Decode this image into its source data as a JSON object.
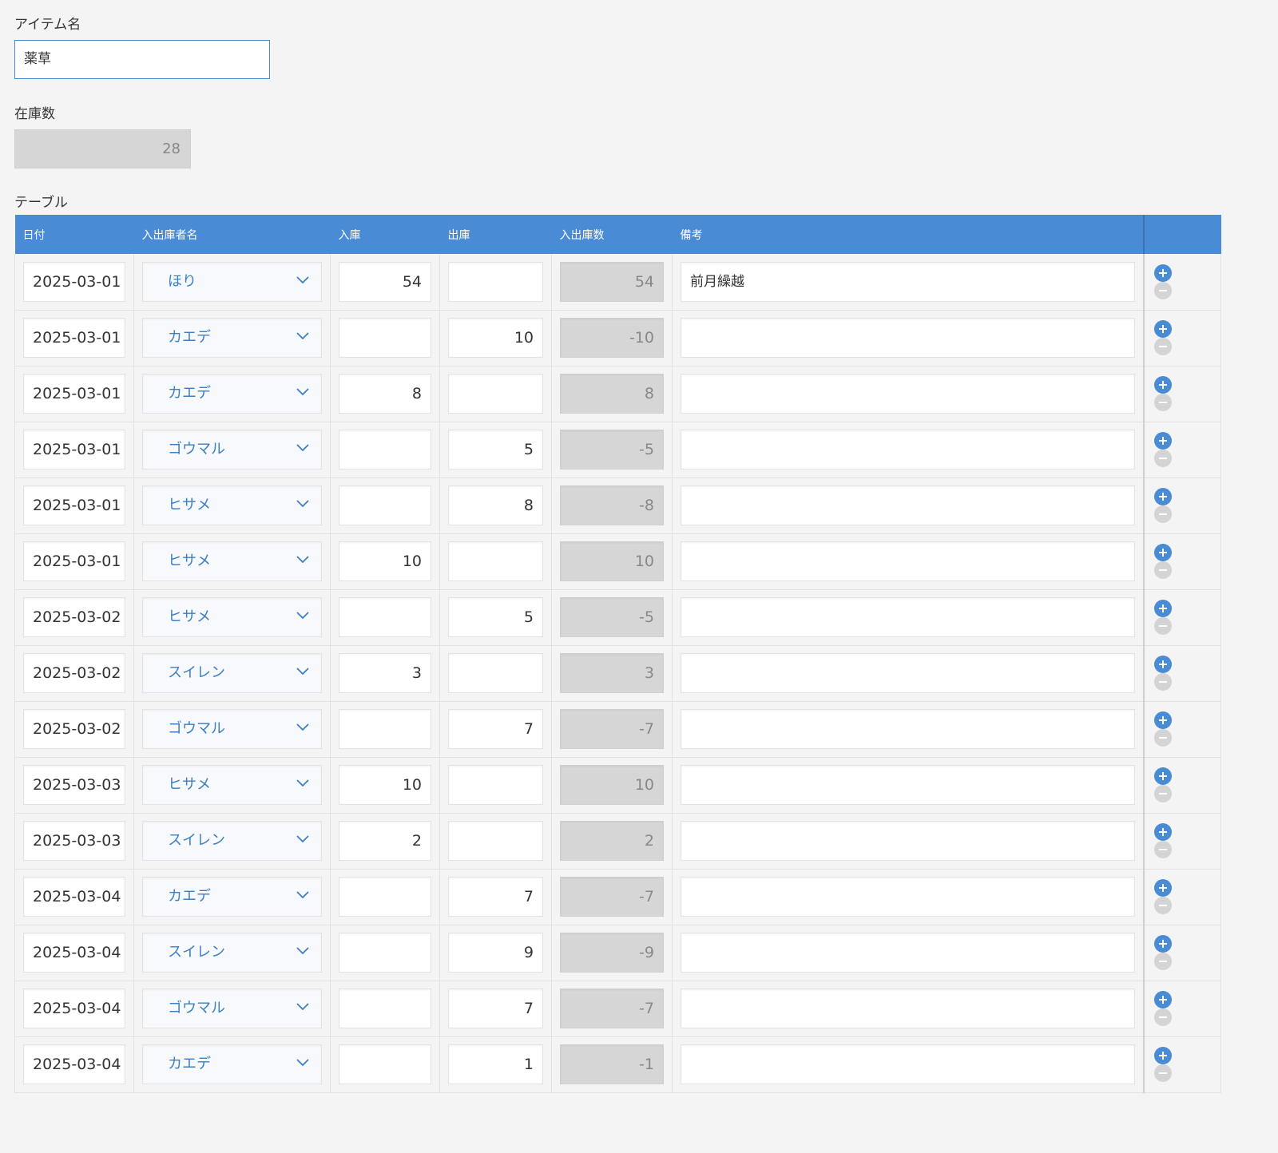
{
  "item_name": {
    "label": "アイテム名",
    "value": "薬草"
  },
  "stock": {
    "label": "在庫数",
    "value": "28"
  },
  "table": {
    "label": "テーブル",
    "columns": [
      "日付",
      "入出庫者名",
      "入庫",
      "出庫",
      "入出庫数",
      "備考"
    ],
    "rows": [
      {
        "date": "2025-03-01",
        "person": "ほり",
        "in": "54",
        "out": "",
        "net": "54",
        "memo": "前月繰越"
      },
      {
        "date": "2025-03-01",
        "person": "カエデ",
        "in": "",
        "out": "10",
        "net": "-10",
        "memo": ""
      },
      {
        "date": "2025-03-01",
        "person": "カエデ",
        "in": "8",
        "out": "",
        "net": "8",
        "memo": ""
      },
      {
        "date": "2025-03-01",
        "person": "ゴウマル",
        "in": "",
        "out": "5",
        "net": "-5",
        "memo": ""
      },
      {
        "date": "2025-03-01",
        "person": "ヒサメ",
        "in": "",
        "out": "8",
        "net": "-8",
        "memo": ""
      },
      {
        "date": "2025-03-01",
        "person": "ヒサメ",
        "in": "10",
        "out": "",
        "net": "10",
        "memo": ""
      },
      {
        "date": "2025-03-02",
        "person": "ヒサメ",
        "in": "",
        "out": "5",
        "net": "-5",
        "memo": ""
      },
      {
        "date": "2025-03-02",
        "person": "スイレン",
        "in": "3",
        "out": "",
        "net": "3",
        "memo": ""
      },
      {
        "date": "2025-03-02",
        "person": "ゴウマル",
        "in": "",
        "out": "7",
        "net": "-7",
        "memo": ""
      },
      {
        "date": "2025-03-03",
        "person": "ヒサメ",
        "in": "10",
        "out": "",
        "net": "10",
        "memo": ""
      },
      {
        "date": "2025-03-03",
        "person": "スイレン",
        "in": "2",
        "out": "",
        "net": "2",
        "memo": ""
      },
      {
        "date": "2025-03-04",
        "person": "カエデ",
        "in": "",
        "out": "7",
        "net": "-7",
        "memo": ""
      },
      {
        "date": "2025-03-04",
        "person": "スイレン",
        "in": "",
        "out": "9",
        "net": "-9",
        "memo": ""
      },
      {
        "date": "2025-03-04",
        "person": "ゴウマル",
        "in": "",
        "out": "7",
        "net": "-7",
        "memo": ""
      },
      {
        "date": "2025-03-04",
        "person": "カエデ",
        "in": "",
        "out": "1",
        "net": "-1",
        "memo": ""
      }
    ],
    "row_icons": {
      "add": "plus-circle-icon",
      "remove": "minus-circle-icon",
      "select": "chevron-down-icon"
    }
  },
  "colors": {
    "accent": "#4a8bd6",
    "select_text": "#3b7fc4",
    "readonly_bg": "#d6d6d6",
    "background": "#f4f4f4"
  }
}
